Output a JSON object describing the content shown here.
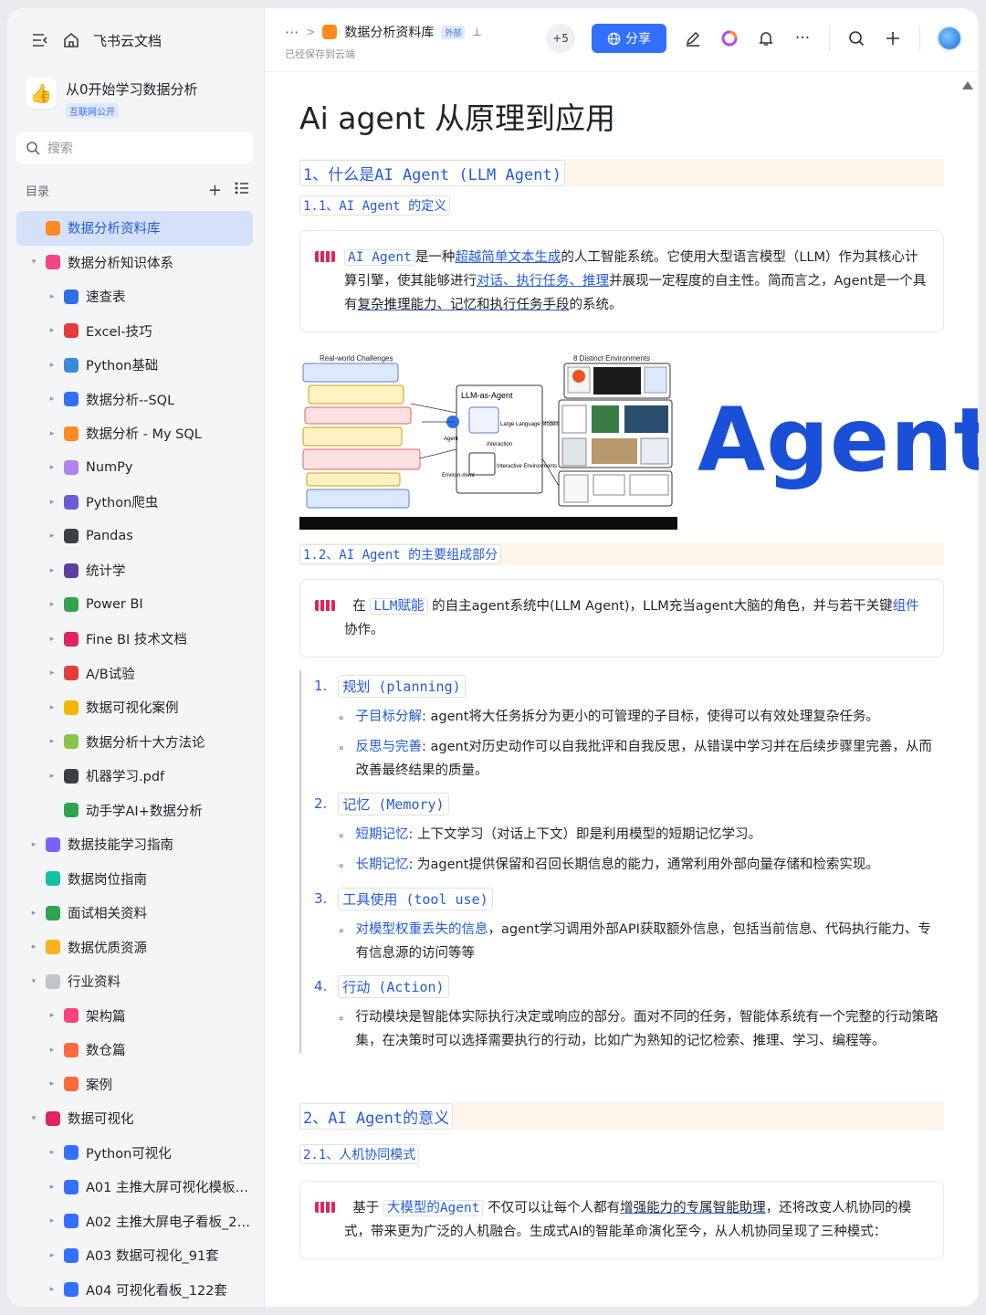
{
  "app": {
    "name": "飞书云文档"
  },
  "kb": {
    "name": "从0开始学习数据分析",
    "badge": "互联网公开"
  },
  "search": {
    "placeholder": "搜索"
  },
  "toc": {
    "label": "目录"
  },
  "tree": [
    {
      "label": "数据分析资料库",
      "level": 1,
      "active": true,
      "arrow": "",
      "color": "#ff8a1f"
    },
    {
      "label": "数据分析知识体系",
      "level": 1,
      "arrow": "▾",
      "color": "#f5447f"
    },
    {
      "label": "速查表",
      "level": 2,
      "arrow": "▸",
      "color": "#2f6fe8"
    },
    {
      "label": "Excel-技巧",
      "level": 2,
      "arrow": "▸",
      "color": "#e33c3c"
    },
    {
      "label": "Python基础",
      "level": 2,
      "arrow": "▸",
      "color": "#3a8bd9"
    },
    {
      "label": "数据分析--SQL",
      "level": 2,
      "arrow": "▸",
      "color": "#3370ff"
    },
    {
      "label": "数据分析 - My SQL",
      "level": 2,
      "arrow": "▸",
      "color": "#ff8a1f"
    },
    {
      "label": "NumPy",
      "level": 2,
      "arrow": "▸",
      "color": "#b084e8"
    },
    {
      "label": "Python爬虫",
      "level": 2,
      "arrow": "▸",
      "color": "#6b5cd6"
    },
    {
      "label": "Pandas",
      "level": 2,
      "arrow": "▸",
      "color": "#3b3f45"
    },
    {
      "label": "统计学",
      "level": 2,
      "arrow": "▸",
      "color": "#5a3fa0"
    },
    {
      "label": "Power BI",
      "level": 2,
      "arrow": "▸",
      "color": "#2ea44f"
    },
    {
      "label": "Fine BI 技术文档",
      "level": 2,
      "arrow": "▸",
      "color": "#e0245e"
    },
    {
      "label": "A/B试验",
      "level": 2,
      "arrow": "▸",
      "color": "#e33c3c"
    },
    {
      "label": "数据可视化案例",
      "level": 2,
      "arrow": "▸",
      "color": "#f2b600"
    },
    {
      "label": "数据分析十大方法论",
      "level": 2,
      "arrow": "▸",
      "color": "#8bc34a"
    },
    {
      "label": "机器学习.pdf",
      "level": 2,
      "arrow": "▸",
      "color": "#3b3f45"
    },
    {
      "label": "动手学AI+数据分析",
      "level": 2,
      "arrow": "",
      "color": "#2ea44f"
    },
    {
      "label": "数据技能学习指南",
      "level": 1,
      "arrow": "▸",
      "color": "#7b61ff"
    },
    {
      "label": "数据岗位指南",
      "level": 1,
      "arrow": "",
      "color": "#14c0a6"
    },
    {
      "label": "面试相关资料",
      "level": 1,
      "arrow": "▸",
      "color": "#2ea44f"
    },
    {
      "label": "数据优质资源",
      "level": 1,
      "arrow": "▸",
      "color": "#ffb01f"
    },
    {
      "label": "行业资料",
      "level": 1,
      "arrow": "▾",
      "color": "#c0c4cc"
    },
    {
      "label": "架构篇",
      "level": 2,
      "arrow": "▸",
      "color": "#f5447f"
    },
    {
      "label": "数仓篇",
      "level": 2,
      "arrow": "▸",
      "color": "#ff6a3d"
    },
    {
      "label": "案例",
      "level": 2,
      "arrow": "▸",
      "color": "#ff6a3d"
    },
    {
      "label": "数据可视化",
      "level": 1,
      "arrow": "▾",
      "color": "#e0245e"
    },
    {
      "label": "Python可视化",
      "level": 2,
      "arrow": "▸",
      "color": "#3370ff"
    },
    {
      "label": "A01 主推大屏可视化模板_...",
      "level": 2,
      "arrow": "▸",
      "color": "#3370ff"
    },
    {
      "label": "A02 主推大屏电子看板_20套",
      "level": 2,
      "arrow": "▸",
      "color": "#3370ff"
    },
    {
      "label": "A03 数据可视化_91套",
      "level": 2,
      "arrow": "▸",
      "color": "#3370ff"
    },
    {
      "label": "A04 可视化看板_122套",
      "level": 2,
      "arrow": "▸",
      "color": "#3370ff"
    }
  ],
  "topbar": {
    "dots": "···",
    "doc_name": "数据分析资料库",
    "external_badge": "外部",
    "saved": "已经保存到云端",
    "collab_count": "+5",
    "share": "分享"
  },
  "doc": {
    "title": "Ai agent 从原理到应用",
    "h1_1": "1、什么是AI Agent (LLM Agent)",
    "h2_1": "1.1、AI Agent 的定义",
    "c1": {
      "code": "AI Agent",
      "t1": "是一种",
      "link1": "超越简单文本生成",
      "t2": "的人工智能系统。它使用大型语言模型（LLM）作为其核心计算引擎，使其能够进行",
      "link2": "对话、执行任务、推理",
      "t3": "并展现一定程度的自主性。简而言之，Agent是一个具有",
      "ul": "复杂推理能力、记忆和执行任务手段",
      "t4": "的系统。"
    },
    "image_text": "Agent",
    "h2_2": "1.2、AI Agent 的主要组成部分",
    "c2": {
      "t1": "在",
      "code": "LLM赋能",
      "t2": "的自主agent系统中(LLM Agent)，LLM充当agent大脑的角色，并与若干关键",
      "link": "组件",
      "t3": "协作。"
    },
    "items": [
      {
        "n": "1.",
        "head": "规划 (planning)",
        "subs": [
          {
            "k": "子目标分解",
            "v": ": agent将大任务拆分为更小的可管理的子目标，使得可以有效处理复杂任务。"
          },
          {
            "k": "反思与完善",
            "v": ": agent对历史动作可以自我批评和自我反思，从错误中学习并在后续步骤里完善，从而改善最终结果的质量。"
          }
        ]
      },
      {
        "n": "2.",
        "head": "记忆 (Memory)",
        "subs": [
          {
            "k": "短期记忆",
            "v": ": 上下文学习（对话上下文）即是利用模型的短期记忆学习。"
          },
          {
            "k": "长期记忆",
            "v": ": 为agent提供保留和召回长期信息的能力，通常利用外部向量存储和检索实现。"
          }
        ]
      },
      {
        "n": "3.",
        "head": "工具使用 (tool use)",
        "subs": [
          {
            "k": "对模型权重丢失的信息",
            "v": "，agent学习调用外部API获取额外信息，包括当前信息、代码执行能力、专有信息源的访问等等"
          }
        ]
      },
      {
        "n": "4.",
        "head": "行动 (Action)",
        "subs": [
          {
            "k": "",
            "v": "行动模块是智能体实际执行决定或响应的部分。面对不同的任务，智能体系统有一个完整的行动策略集，在决策时可以选择需要执行的行动，比如广为熟知的记忆检索、推理、学习、编程等。"
          }
        ]
      }
    ],
    "h1_2": "2、AI Agent的意义",
    "h2_3": "2.1、人机协同模式",
    "c3": {
      "t1": "基于",
      "code": "大模型的Agent",
      "t2": "不仅可以让每个人都有",
      "ul": "增强能力的专属智能助理",
      "t3": "，还将改变人机协同的模式，带来更为广泛的人机融合。生成式AI的智能革命演化至今，从人机协同呈现了三种模式："
    }
  },
  "diagram": {
    "left_title": "Real-world Challenges",
    "right_title": "8 Distinct Environments",
    "center_title": "LLM-as-Agent",
    "llm": "Large Language Models",
    "interaction": "Interaction",
    "env": "Interactive Environments",
    "agent": "Agent",
    "environment": "Environ-ment"
  },
  "colors": {
    "accent": "#3370ff",
    "link": "#245bdb",
    "heading_bg": "#fff5eb"
  }
}
